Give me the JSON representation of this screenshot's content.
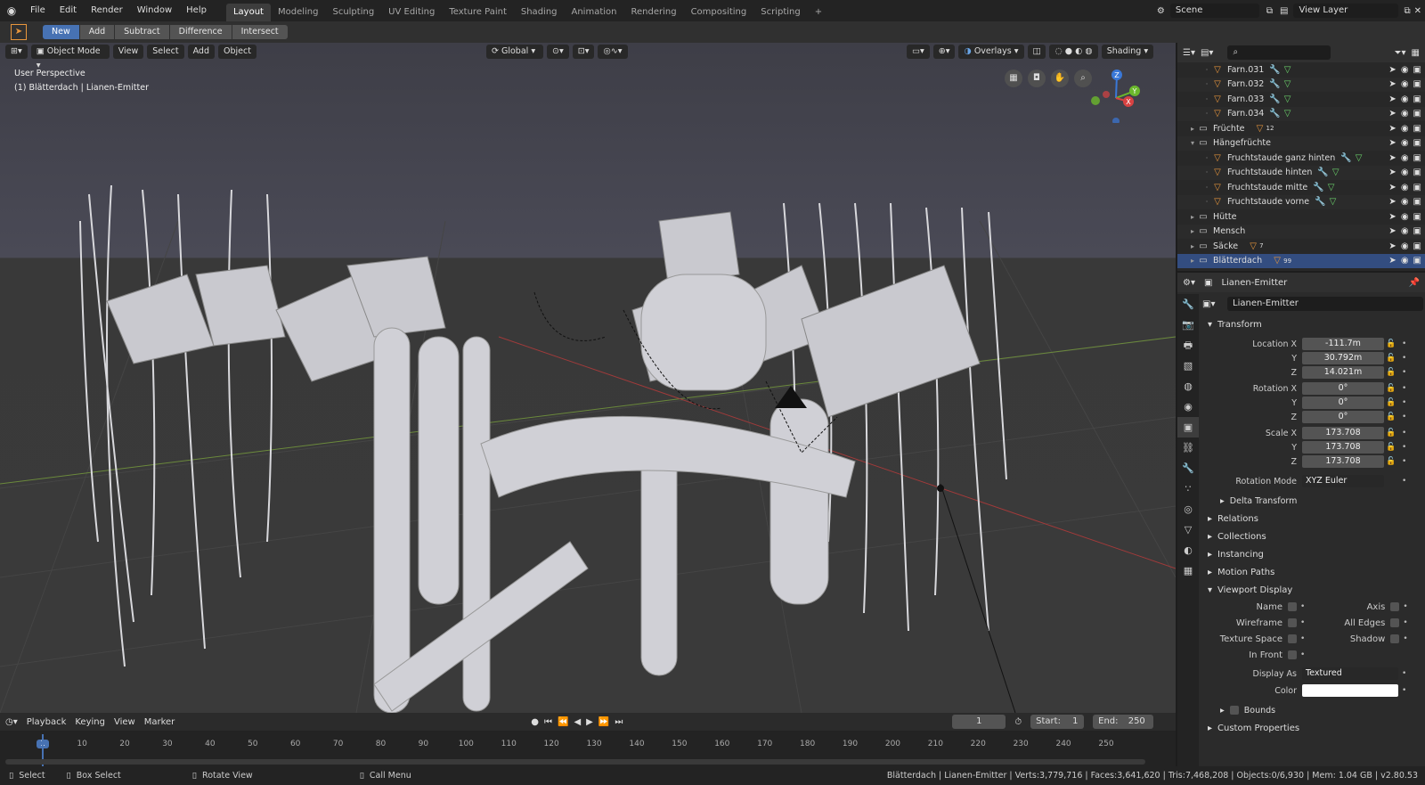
{
  "topbar": {
    "menus": [
      "File",
      "Edit",
      "Render",
      "Window",
      "Help"
    ],
    "workspaces": [
      "Layout",
      "Modeling",
      "Sculpting",
      "UV Editing",
      "Texture Paint",
      "Shading",
      "Animation",
      "Rendering",
      "Compositing",
      "Scripting"
    ],
    "active_workspace": "Layout",
    "add_tab": "+",
    "scene": "Scene",
    "view_layer": "View Layer"
  },
  "toolheader": {
    "buttons": [
      "New",
      "Add",
      "Subtract",
      "Difference",
      "Intersect"
    ],
    "active": "New"
  },
  "viewport": {
    "mode": "Object Mode",
    "menus": [
      "View",
      "Select",
      "Add",
      "Object"
    ],
    "orientation": "Global",
    "overlays": "Overlays",
    "shading": "Shading",
    "perspective": "User Perspective",
    "active_info": "(1) Blätterdach | Lianen-Emitter",
    "gizmo_axes": [
      "Z",
      "Y",
      "X"
    ]
  },
  "outliner": {
    "search_placeholder": "",
    "rows": [
      {
        "name": "Farn.031",
        "type": "object",
        "indent": 2
      },
      {
        "name": "Farn.032",
        "type": "object",
        "indent": 2
      },
      {
        "name": "Farn.033",
        "type": "object",
        "indent": 2
      },
      {
        "name": "Farn.034",
        "type": "object",
        "indent": 2
      },
      {
        "name": "Früchte",
        "type": "collection",
        "indent": 1,
        "badge": "12"
      },
      {
        "name": "Hängefrüchte",
        "type": "collection",
        "indent": 1
      },
      {
        "name": "Fruchtstaude ganz hinten",
        "type": "object",
        "indent": 2
      },
      {
        "name": "Fruchtstaude hinten",
        "type": "object",
        "indent": 2
      },
      {
        "name": "Fruchtstaude mitte",
        "type": "object",
        "indent": 2
      },
      {
        "name": "Fruchtstaude vorne",
        "type": "object",
        "indent": 2
      },
      {
        "name": "Hütte",
        "type": "collection",
        "indent": 1
      },
      {
        "name": "Mensch",
        "type": "collection",
        "indent": 1
      },
      {
        "name": "Säcke",
        "type": "collection",
        "indent": 1,
        "badge": "7"
      },
      {
        "name": "Blätterdach",
        "type": "collection",
        "indent": 1,
        "badge": "99",
        "selected": true
      }
    ]
  },
  "properties": {
    "object_name": "Lianen-Emitter",
    "datablock": "Lianen-Emitter",
    "transform_title": "Transform",
    "location_label": "Location X",
    "location": [
      "-111.7m",
      "30.792m",
      "14.021m"
    ],
    "rotation_label": "Rotation X",
    "rotation": [
      "0°",
      "0°",
      "0°"
    ],
    "scale_label": "Scale X",
    "scale": [
      "173.708",
      "173.708",
      "173.708"
    ],
    "y_label": "Y",
    "z_label": "Z",
    "rotation_mode_label": "Rotation Mode",
    "rotation_mode": "XYZ Euler",
    "delta": "Delta Transform",
    "panels": [
      "Relations",
      "Collections",
      "Instancing",
      "Motion Paths"
    ],
    "viewport_display": "Viewport Display",
    "vd_left": [
      "Name",
      "Wireframe",
      "Texture Space",
      "In Front"
    ],
    "vd_right": [
      "Axis",
      "All Edges",
      "Shadow"
    ],
    "display_as_label": "Display As",
    "display_as": "Textured",
    "color_label": "Color",
    "bounds": "Bounds",
    "custom_props": "Custom Properties"
  },
  "timeline": {
    "menus": [
      "Playback",
      "Keying",
      "View",
      "Marker"
    ],
    "current_frame": "1",
    "start_label": "Start:",
    "start": "1",
    "end_label": "End:",
    "end": "250",
    "ticks": [
      "1",
      "10",
      "20",
      "30",
      "40",
      "50",
      "60",
      "70",
      "80",
      "90",
      "100",
      "110",
      "120",
      "130",
      "140",
      "150",
      "160",
      "170",
      "180",
      "190",
      "200",
      "210",
      "220",
      "230",
      "240",
      "250"
    ]
  },
  "statusbar": {
    "select": "Select",
    "box_select": "Box Select",
    "rotate_view": "Rotate View",
    "call_menu": "Call Menu",
    "stats": "Blätterdach | Lianen-Emitter | Verts:3,779,716 | Faces:3,641,620 | Tris:7,468,208 | Objects:0/6,930 | Mem: 1.04 GB | v2.80.53"
  },
  "colors": {
    "accent": "#4772b3",
    "object_icon": "#e8963c",
    "selected_row": "#334d80"
  }
}
